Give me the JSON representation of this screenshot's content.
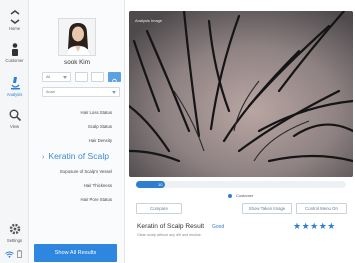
{
  "nav": {
    "home": "Home",
    "customer": "Customer",
    "analysis": "Analysis",
    "view": "View",
    "settings": "Settings"
  },
  "profile": {
    "name": "sook Kim"
  },
  "filters": {
    "select1": "All",
    "select2": "Anari"
  },
  "menu": {
    "items": [
      "Hair Loss Status",
      "Scalp Status",
      "Hair Density",
      "Keratin of Scalp",
      "Exposure of Scalp's Vessel",
      "Hair Thickness",
      "Hair Pore Status"
    ],
    "active_index": 3
  },
  "show_all_label": "Show All Results",
  "image": {
    "label": "Analysis Image"
  },
  "progress": {
    "value_text": "10",
    "fill_percent": 14
  },
  "legend": {
    "customer": "Customer"
  },
  "actions": {
    "compare": "Compare",
    "show_taken_image": "Show Taken Image",
    "control_menu_on": "Control Menu On"
  },
  "result": {
    "title": "Keratin of Scalp Result",
    "grade": "Good",
    "description": "Clean scalp without any dirt and residue.",
    "stars": "★★★★★",
    "rating": 5
  },
  "colors": {
    "accent": "#2f7fd0",
    "button": "#2e86de"
  }
}
